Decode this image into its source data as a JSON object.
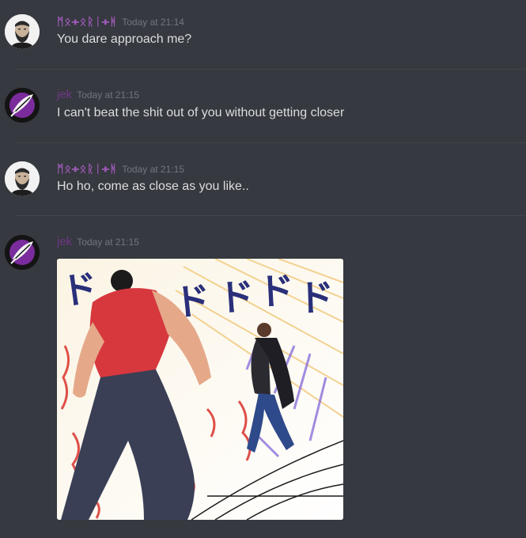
{
  "colors": {
    "background": "#36393f",
    "text": "#dcddde",
    "timestamp": "#72767d",
    "divider": "#42454a",
    "user_motorith": "#9b59b6",
    "user_jek": "#71368a"
  },
  "messages": [
    {
      "author": "ᛗᛟᚐᛟᚱᛁᚐᚻ",
      "author_color": "#9b59b6",
      "timestamp": "Today at 21:14",
      "text": "You dare approach me?",
      "avatar": "bearded-man-avatar"
    },
    {
      "author": "jek",
      "author_color": "#71368a",
      "timestamp": "Today at 21:15",
      "text": "I can't beat the shit out of you without getting closer",
      "avatar": "purple-feather-avatar"
    },
    {
      "author": "ᛗᛟᚐᛟᚱᛁᚐᚻ",
      "author_color": "#9b59b6",
      "timestamp": "Today at 21:15",
      "text": "Ho ho, come as close as you like..",
      "avatar": "bearded-man-avatar"
    },
    {
      "author": "jek",
      "author_color": "#71368a",
      "timestamp": "Today at 21:15",
      "text": "",
      "avatar": "purple-feather-avatar",
      "attachment": {
        "type": "image",
        "description_icon": "jojo-approach-meme-image",
        "glyphs": "ドドドドド"
      }
    }
  ]
}
